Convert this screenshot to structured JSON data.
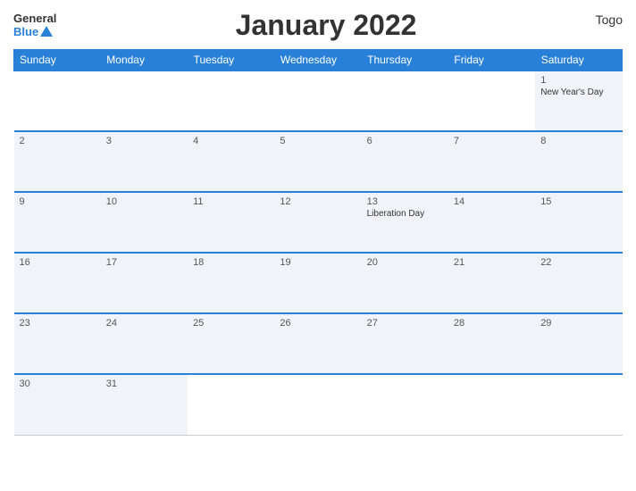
{
  "header": {
    "logo_general": "General",
    "logo_blue": "Blue",
    "title": "January 2022",
    "country": "Togo"
  },
  "calendar": {
    "weekdays": [
      "Sunday",
      "Monday",
      "Tuesday",
      "Wednesday",
      "Thursday",
      "Friday",
      "Saturday"
    ],
    "weeks": [
      [
        {
          "day": "",
          "holiday": ""
        },
        {
          "day": "",
          "holiday": ""
        },
        {
          "day": "",
          "holiday": ""
        },
        {
          "day": "",
          "holiday": ""
        },
        {
          "day": "",
          "holiday": ""
        },
        {
          "day": "",
          "holiday": ""
        },
        {
          "day": "1",
          "holiday": "New Year's Day"
        }
      ],
      [
        {
          "day": "2",
          "holiday": ""
        },
        {
          "day": "3",
          "holiday": ""
        },
        {
          "day": "4",
          "holiday": ""
        },
        {
          "day": "5",
          "holiday": ""
        },
        {
          "day": "6",
          "holiday": ""
        },
        {
          "day": "7",
          "holiday": ""
        },
        {
          "day": "8",
          "holiday": ""
        }
      ],
      [
        {
          "day": "9",
          "holiday": ""
        },
        {
          "day": "10",
          "holiday": ""
        },
        {
          "day": "11",
          "holiday": ""
        },
        {
          "day": "12",
          "holiday": ""
        },
        {
          "day": "13",
          "holiday": "Liberation Day"
        },
        {
          "day": "14",
          "holiday": ""
        },
        {
          "day": "15",
          "holiday": ""
        }
      ],
      [
        {
          "day": "16",
          "holiday": ""
        },
        {
          "day": "17",
          "holiday": ""
        },
        {
          "day": "18",
          "holiday": ""
        },
        {
          "day": "19",
          "holiday": ""
        },
        {
          "day": "20",
          "holiday": ""
        },
        {
          "day": "21",
          "holiday": ""
        },
        {
          "day": "22",
          "holiday": ""
        }
      ],
      [
        {
          "day": "23",
          "holiday": ""
        },
        {
          "day": "24",
          "holiday": ""
        },
        {
          "day": "25",
          "holiday": ""
        },
        {
          "day": "26",
          "holiday": ""
        },
        {
          "day": "27",
          "holiday": ""
        },
        {
          "day": "28",
          "holiday": ""
        },
        {
          "day": "29",
          "holiday": ""
        }
      ],
      [
        {
          "day": "30",
          "holiday": ""
        },
        {
          "day": "31",
          "holiday": ""
        },
        {
          "day": "",
          "holiday": ""
        },
        {
          "day": "",
          "holiday": ""
        },
        {
          "day": "",
          "holiday": ""
        },
        {
          "day": "",
          "holiday": ""
        },
        {
          "day": "",
          "holiday": ""
        }
      ]
    ]
  }
}
